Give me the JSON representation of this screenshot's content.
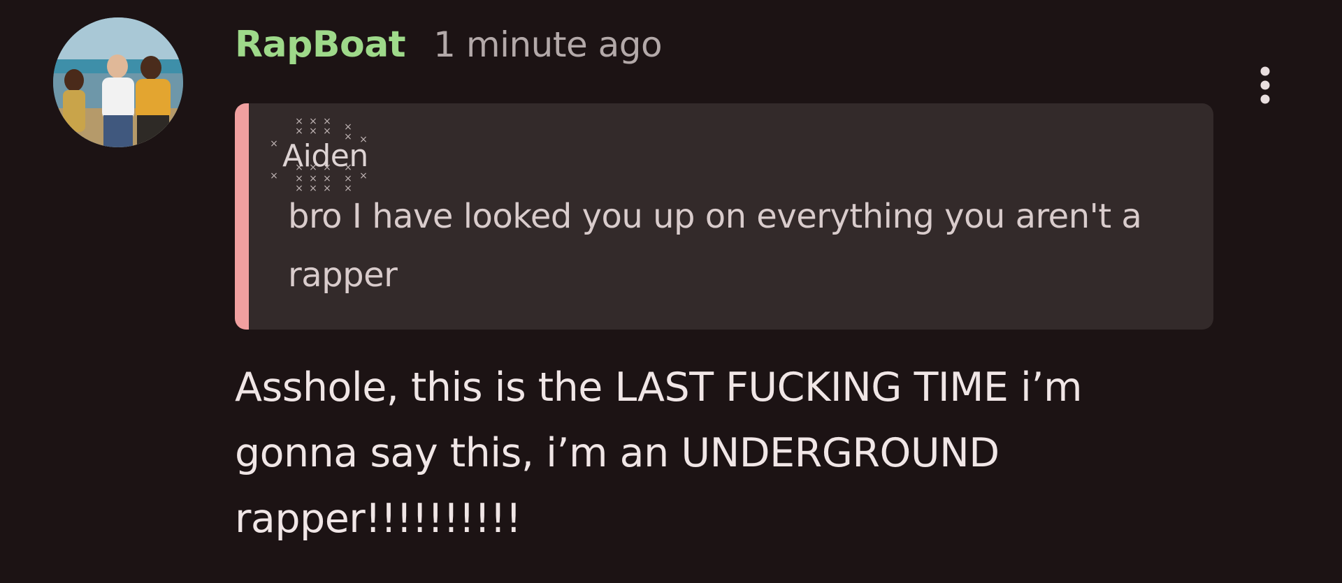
{
  "comment": {
    "author": "RapBoat",
    "timestamp": "1 minute ago",
    "avatar": {
      "icon": "user-avatar-photo"
    },
    "menu_icon": "more-vertical-icon",
    "quote": {
      "author": "Aiden",
      "text": "bro I have looked you up on everything you aren't a rapper",
      "accent_color": "#f0a0a0"
    },
    "body": "Asshole, this is the LAST FUCKING TIME i’m gonna say this, i’m an UNDERGROUND rapper!!!!!!!!!!"
  },
  "colors": {
    "background": "#1c1314",
    "username": "#9ed98a",
    "timestamp": "#b3a9a9",
    "quote_background": "#332a2a",
    "body_text": "#f0e6e6"
  }
}
